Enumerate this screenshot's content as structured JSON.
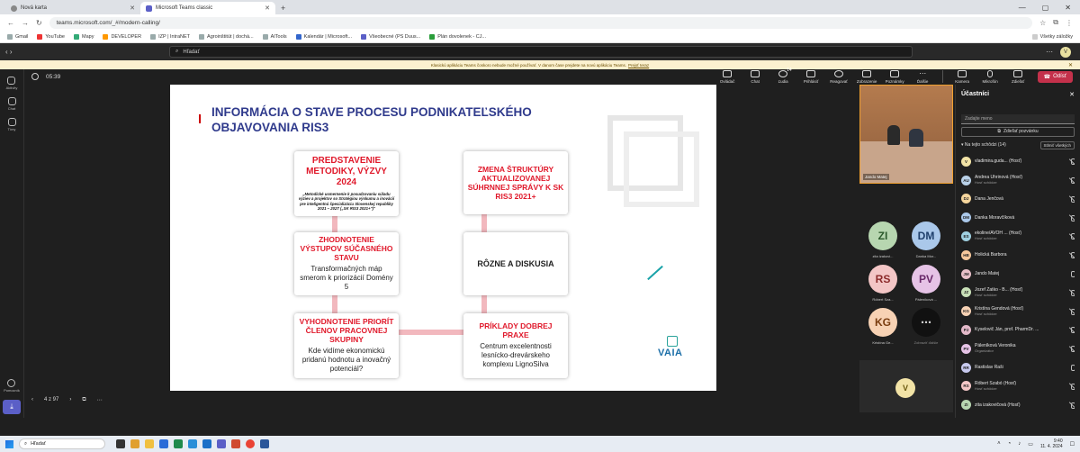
{
  "browser": {
    "tabs": [
      {
        "title": "Nová karta",
        "active": false
      },
      {
        "title": "Microsoft Teams classic",
        "active": true
      }
    ],
    "url": "teams.microsoft.com/_#/modern-calling/",
    "bookmarks": [
      "Gmail",
      "YouTube",
      "Mapy",
      "DEVELOPER",
      "IZP | IntraNET",
      "Agroinštitút | dochá...",
      "AITools",
      "Kalendár | Microsoft...",
      "Všeobecné (PS Duus...",
      "Plán dovolenek - CJ..."
    ],
    "all_bookmarks": "Všetky záložky"
  },
  "teams": {
    "search_placeholder": "Hľadať",
    "me_initial": "V",
    "notice_text": "Klasickú aplikáciu Teams čoskoro nebude možné používať. V danom čase prejdete na novú aplikáciu Teams.",
    "notice_link": "Prejsť teraz",
    "rail": [
      {
        "label": "Aktivity"
      },
      {
        "label": "Chat"
      },
      {
        "label": "Tímy"
      }
    ],
    "rail_bottom": "Pomocník"
  },
  "meeting": {
    "timer": "05:39",
    "actions": [
      {
        "label": "Ovládač"
      },
      {
        "label": "Chat"
      },
      {
        "label": "Ľudia",
        "badge": "14"
      },
      {
        "label": "Prihlásiť"
      },
      {
        "label": "Reagovať"
      },
      {
        "label": "Zobrazenie"
      },
      {
        "label": "Poznámky"
      },
      {
        "label": "Ďalšie"
      }
    ],
    "media": [
      {
        "label": "Kamera"
      },
      {
        "label": "Mikrofón"
      },
      {
        "label": "Zdieľať"
      }
    ],
    "leave_label": "Odísť"
  },
  "slide": {
    "title": "INFORMÁCIA O STAVE PROCESU PODNIKATEĽSKÉHO OBJAVOVANIA RIS3",
    "box1_head": "PREDSTAVENIE METODIKY, VÝZVY 2024",
    "box1_text": "„Metodické usmernenie k posudzovaniu súladu výziev a projektov so Stratégiou výskumu a inovácií pre inteligentnú špecializáciu Slovenskej republiky 2021 – 2027 („SK RIS3 2021+\")\"",
    "box2_head": "ZMENA ŠTRUKTÚRY AKTUALIZOVANEJ SÚHRNNEJ SPRÁVY K SK RIS3 2021+",
    "box3_head": "ZHODNOTENIE VÝSTUPOV SÚČASNÉHO STAVU",
    "box3_text": "Transformačných máp smerom k priorizácií Domény 5",
    "box4_head": "RÔZNE A DISKUSIA",
    "box5_head": "VYHODNOTENIE PRIORÍT ČLENOV PRACOVNEJ SKUPINY",
    "box5_text": "Kde vidíme ekonomickú pridanú hodnotu a inovačný potenciál?",
    "box6_head": "PRÍKLADY DOBREJ PRAXE",
    "box6_text": "Centrum excelentnosti lesnícko-drevárskeho komplexu LignoSilva",
    "logo": "VAIA",
    "page_indicator": "4 z 97"
  },
  "tiles": {
    "video_name": "Jando Matej",
    "avatars": [
      {
        "initials": "ZI",
        "label": "zita izakovi...",
        "bg": "#b7d6b0",
        "fg": "#2c5a2c"
      },
      {
        "initials": "DM",
        "label": "Danka Mor...",
        "bg": "#aac8ea",
        "fg": "#1f3f6b"
      },
      {
        "initials": "RS",
        "label": "Róbert Sza...",
        "bg": "#f3c6c6",
        "fg": "#8b2a2a"
      },
      {
        "initials": "PV",
        "label": "Páleníková ...",
        "bg": "#e6c3e6",
        "fg": "#6b2a6b"
      },
      {
        "initials": "KG",
        "label": "Kristína Ge...",
        "bg": "#f7d2b4",
        "fg": "#7a3d10"
      },
      {
        "initials": "⋯",
        "label": "Zobraziť ďalšie",
        "bg": "#111111",
        "fg": "#cccccc"
      }
    ],
    "bottom_initial": "V"
  },
  "participants": {
    "title": "Účastníci",
    "invite_placeholder": "Zadajte meno",
    "share_invite": "Zdieľať pozvánku",
    "section": "Na tejto schôdzi (14)",
    "mute_all": "Stlmiť všetkých",
    "list": [
      {
        "initials": "V",
        "name": "vladimira.guda... (Hosť)",
        "sub": "",
        "bg": "#f2e3a6",
        "mic": "off"
      },
      {
        "initials": "AU",
        "name": "Andrea Uhrinová (Hosť)",
        "sub": "Hosť schôdze",
        "bg": "#b9d1e8",
        "mic": "off"
      },
      {
        "initials": "DJ",
        "name": "Dana Jenčová",
        "sub": "",
        "bg": "#f5d59c",
        "mic": "off"
      },
      {
        "initials": "DM",
        "name": "Danka Moravčíková",
        "sub": "",
        "bg": "#aac8ea",
        "mic": "off"
      },
      {
        "initials": "ES",
        "name": "ekoline/AVOH ... (Hosť)",
        "sub": "Hosť schôdze",
        "bg": "#9fd0e0",
        "mic": "off"
      },
      {
        "initials": "HB",
        "name": "Holická Barbora",
        "sub": "",
        "bg": "#f6c79b",
        "mic": "off"
      },
      {
        "initials": "JM",
        "name": "Jando Matej",
        "sub": "",
        "bg": "#e8c0c8",
        "mic": "on"
      },
      {
        "initials": "JZ",
        "name": "Jozef Žatko - B... (Hosť)",
        "sub": "Hosť schôdze",
        "bg": "#c9e0b8",
        "mic": "off"
      },
      {
        "initials": "KG",
        "name": "Kristína Gendová (Hosť)",
        "sub": "Hosť schôdze",
        "bg": "#f7d2b4",
        "mic": "off"
      },
      {
        "initials": "PJ",
        "name": "Kyselovič Ján, prof. PharmDr. ...",
        "sub": "",
        "bg": "#e3b9c9",
        "mic": "off"
      },
      {
        "initials": "PV",
        "name": "Páleníková Veronika",
        "sub": "Organizátor",
        "bg": "#e6c3e6",
        "mic": "off"
      },
      {
        "initials": "RR",
        "name": "Rastislav Raši",
        "sub": "",
        "bg": "#c7c9ee",
        "mic": "on"
      },
      {
        "initials": "RS",
        "name": "Róbert Szabó (Hosť)",
        "sub": "Hosť schôdze",
        "bg": "#f3c6c6",
        "mic": "off"
      },
      {
        "initials": "ZI",
        "name": "zita izakovičová (Hosť)",
        "sub": "",
        "bg": "#b7d6b0",
        "mic": "off"
      }
    ]
  },
  "taskbar": {
    "search": "Hľadať",
    "time": "9:40",
    "date": "11. 4. 2024"
  }
}
